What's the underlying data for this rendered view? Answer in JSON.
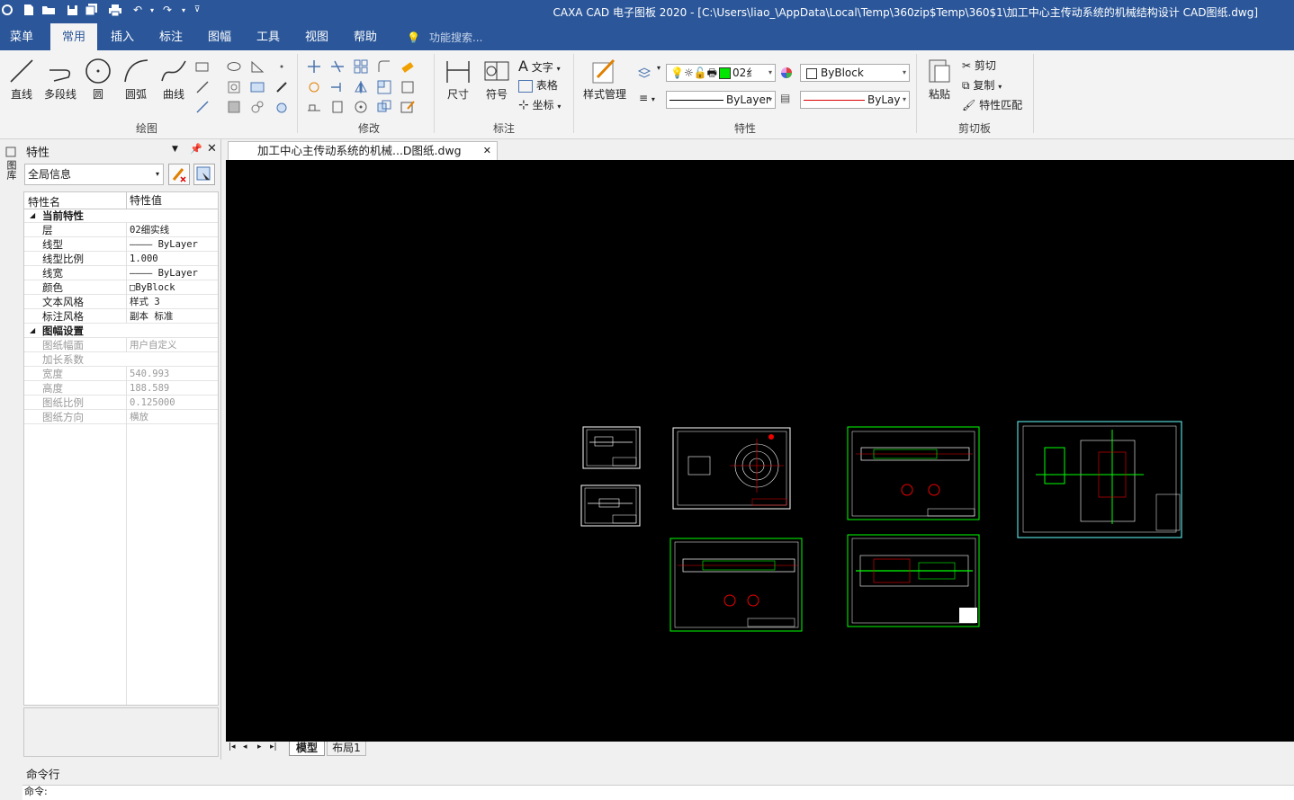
{
  "window": {
    "title": "CAXA CAD 电子图板 2020 - [C:\\Users\\liao_\\AppData\\Local\\Temp\\360zip$Temp\\360$1\\加工中心主传动系统的机械结构设计 CAD图纸.dwg]"
  },
  "menu_tabs": [
    "菜单",
    "常用",
    "插入",
    "标注",
    "图幅",
    "工具",
    "视图",
    "帮助"
  ],
  "active_tab": "常用",
  "search_placeholder": "功能搜索...",
  "ribbon": {
    "draw": {
      "label": "绘图",
      "line": "直线",
      "polyline": "多段线",
      "circle": "圆",
      "arc": "圆弧",
      "curve": "曲线"
    },
    "modify": {
      "label": "修改"
    },
    "annotate": {
      "label": "标注",
      "dimension": "尺寸",
      "symbol": "符号",
      "text": "文字",
      "table": "表格",
      "coord": "坐标"
    },
    "properties": {
      "label": "特性",
      "style_mgr": "样式管理",
      "layer_value": "02纟",
      "color_value": "ByBlock",
      "linetype_value": "ByLayer",
      "linewidth_value": "ByLay"
    },
    "clipboard": {
      "label": "剪切板",
      "paste": "粘贴",
      "cut": "剪切",
      "copy": "复制",
      "match": "特性匹配"
    }
  },
  "colors": {
    "accent": "#2b579a",
    "green_swatch": "#00e600"
  },
  "left_strip": {
    "label": "图库"
  },
  "panel": {
    "title": "特性",
    "scope": "全局信息",
    "col_name": "特性名",
    "col_value": "特性值",
    "rows": [
      {
        "name": "当前特性",
        "value": "",
        "type": "category"
      },
      {
        "name": "层",
        "value": "02细实线",
        "type": "prop"
      },
      {
        "name": "线型",
        "value": "———— ByLayer",
        "type": "prop"
      },
      {
        "name": "线型比例",
        "value": "1.000",
        "type": "prop"
      },
      {
        "name": "线宽",
        "value": "———— ByLayer",
        "type": "prop"
      },
      {
        "name": "颜色",
        "value": "□ByBlock",
        "type": "prop"
      },
      {
        "name": "文本风格",
        "value": "样式 3",
        "type": "prop"
      },
      {
        "name": "标注风格",
        "value": "副本 标准",
        "type": "prop"
      },
      {
        "name": "图幅设置",
        "value": "",
        "type": "category"
      },
      {
        "name": "图纸幅面",
        "value": "用户自定义",
        "type": "disabled"
      },
      {
        "name": "加长系数",
        "value": "",
        "type": "disabled"
      },
      {
        "name": "宽度",
        "value": "540.993",
        "type": "disabled"
      },
      {
        "name": "高度",
        "value": "188.589",
        "type": "disabled"
      },
      {
        "name": "图纸比例",
        "value": "0.125000",
        "type": "disabled"
      },
      {
        "name": "图纸方向",
        "value": "横放",
        "type": "disabled"
      }
    ]
  },
  "document_tab": "加工中心主传动系统的机械...D图纸.dwg",
  "layout_tabs": [
    "模型",
    "布局1"
  ],
  "command": {
    "label": "命令行",
    "prompt": "命令:"
  }
}
